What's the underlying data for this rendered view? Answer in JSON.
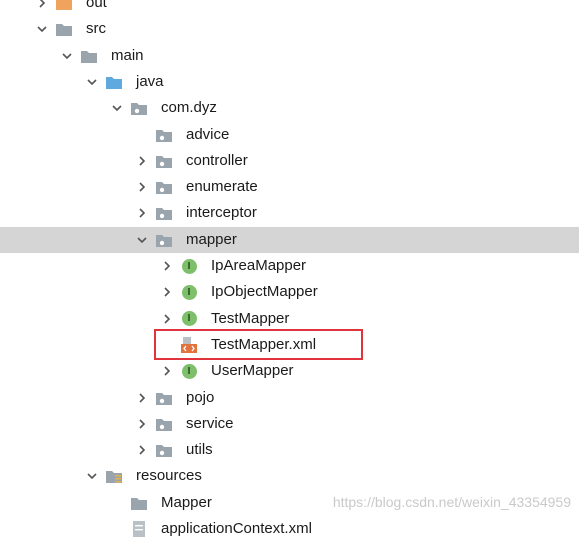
{
  "colors": {
    "selected_row": "#d5d5d5",
    "highlight_border": "#e0333b",
    "folder": "#9aa4ad",
    "source_folder": "#5ea9e0",
    "out_folder": "#f0a35c",
    "interface_badge": "#7dbf6a"
  },
  "tree": [
    {
      "label": "out",
      "arrow": "right",
      "icon": "out-folder-icon",
      "depth": 1
    },
    {
      "label": "src",
      "arrow": "down",
      "icon": "folder-icon",
      "depth": 1
    },
    {
      "label": "main",
      "arrow": "down",
      "icon": "folder-icon",
      "depth": 2
    },
    {
      "label": "java",
      "arrow": "down",
      "icon": "source-folder-icon",
      "depth": 3
    },
    {
      "label": "com.dyz",
      "arrow": "down",
      "icon": "package-icon",
      "depth": 4
    },
    {
      "label": "advice",
      "arrow": "none",
      "icon": "package-icon",
      "depth": 5
    },
    {
      "label": "controller",
      "arrow": "right",
      "icon": "package-icon",
      "depth": 5
    },
    {
      "label": "enumerate",
      "arrow": "right",
      "icon": "package-icon",
      "depth": 5
    },
    {
      "label": "interceptor",
      "arrow": "right",
      "icon": "package-icon",
      "depth": 5
    },
    {
      "label": "mapper",
      "arrow": "down",
      "icon": "package-icon",
      "depth": 5,
      "selected": true
    },
    {
      "label": "IpAreaMapper",
      "arrow": "right",
      "icon": "interface-icon",
      "depth": 6
    },
    {
      "label": "IpObjectMapper",
      "arrow": "right",
      "icon": "interface-icon",
      "depth": 6
    },
    {
      "label": "TestMapper",
      "arrow": "right",
      "icon": "interface-icon",
      "depth": 6
    },
    {
      "label": "TestMapper.xml",
      "arrow": "none",
      "icon": "xml-file-icon",
      "depth": 6,
      "highlighted": true
    },
    {
      "label": "UserMapper",
      "arrow": "right",
      "icon": "interface-icon",
      "depth": 6
    },
    {
      "label": "pojo",
      "arrow": "right",
      "icon": "package-icon",
      "depth": 5
    },
    {
      "label": "service",
      "arrow": "right",
      "icon": "package-icon",
      "depth": 5
    },
    {
      "label": "utils",
      "arrow": "right",
      "icon": "package-icon",
      "depth": 5
    },
    {
      "label": "resources",
      "arrow": "down",
      "icon": "resources-folder-icon",
      "depth": 3
    },
    {
      "label": "Mapper",
      "arrow": "none",
      "icon": "folder-icon",
      "depth": 4
    },
    {
      "label": "applicationContext.xml",
      "arrow": "none",
      "icon": "xml-config-icon",
      "depth": 4
    }
  ],
  "interface_badge_letter": "I",
  "watermark": "https://blog.csdn.net/weixin_43354959"
}
